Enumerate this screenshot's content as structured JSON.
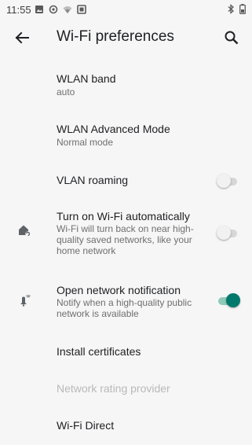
{
  "status_bar": {
    "time": "11:55",
    "left_icons": [
      "gallery-icon",
      "vpn-icon",
      "wifi-icon",
      "screenshot-icon"
    ],
    "right_icons": [
      "bluetooth-icon",
      "battery-icon"
    ]
  },
  "app_bar": {
    "title": "Wi-Fi preferences",
    "back_icon": "back-arrow-icon",
    "search_icon": "search-icon"
  },
  "settings": {
    "wlan_band": {
      "title": "WLAN band",
      "subtitle": "auto"
    },
    "wlan_advanced": {
      "title": "WLAN Advanced Mode",
      "subtitle": "Normal mode"
    },
    "vlan_roaming": {
      "title": "VLAN roaming",
      "enabled": false
    },
    "wifi_auto": {
      "title": "Turn on Wi-Fi automatically",
      "subtitle": "Wi-Fi will turn back on near high-quality saved networks, like your home network",
      "icon": "wifi-home-icon",
      "enabled": false
    },
    "open_network": {
      "title": "Open network notification",
      "subtitle": "Notify when a high-quality public network is available",
      "icon": "wifi-notification-icon",
      "enabled": true
    },
    "install_certificates": {
      "title": "Install certificates"
    },
    "network_rating": {
      "title": "Network rating provider",
      "disabled": true
    },
    "wifi_direct": {
      "title": "Wi-Fi Direct"
    }
  },
  "colors": {
    "accent": "#00796b",
    "background": "#f6f6f6",
    "text_primary": "#202124",
    "text_secondary": "#6f6f6f",
    "text_disabled": "#b9b9b9"
  }
}
